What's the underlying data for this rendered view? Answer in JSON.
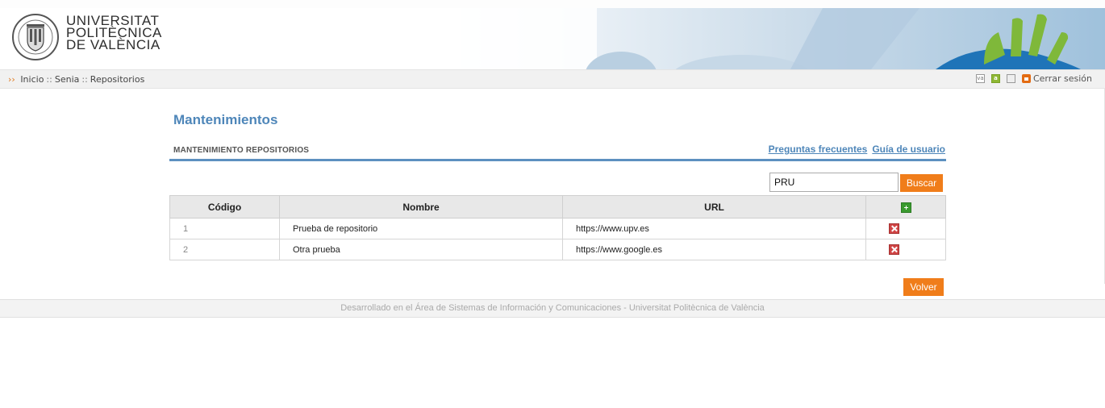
{
  "header": {
    "university_lines": [
      "UNIVERSITAT",
      "POLITÈCNICA",
      "DE VALÈNCIA"
    ]
  },
  "breadcrumb": {
    "arrows": "››",
    "items": [
      "Inicio",
      "Senia",
      "Repositorios"
    ],
    "separator": "::"
  },
  "toolbar": {
    "icons": [
      "language-va-icon",
      "accessibility-a-icon",
      "document-icon",
      "lock-icon"
    ],
    "logout_label": "Cerrar sesión"
  },
  "page": {
    "title": "Mantenimientos",
    "section_title": "MANTENIMIENTO REPOSITORIOS",
    "links": {
      "faq": "Preguntas frecuentes",
      "guide": "Guía de usuario"
    }
  },
  "search": {
    "value": "PRU",
    "button_label": "Buscar"
  },
  "table": {
    "columns": [
      "Código",
      "Nombre",
      "URL"
    ],
    "rows": [
      {
        "code": "1",
        "name": "Prueba de repositorio",
        "url": "https://www.upv.es"
      },
      {
        "code": "2",
        "name": "Otra prueba",
        "url": "https://www.google.es"
      }
    ]
  },
  "actions": {
    "back_label": "Volver"
  },
  "footer": {
    "text": "Desarrollado en el Área de Sistemas de Información y Comunicaciones - Universitat Politècnica de València"
  },
  "colors": {
    "accent_blue": "#4e86b9",
    "orange": "#f07d1a",
    "add_green": "#3a9a2f",
    "delete_red": "#d04545"
  }
}
